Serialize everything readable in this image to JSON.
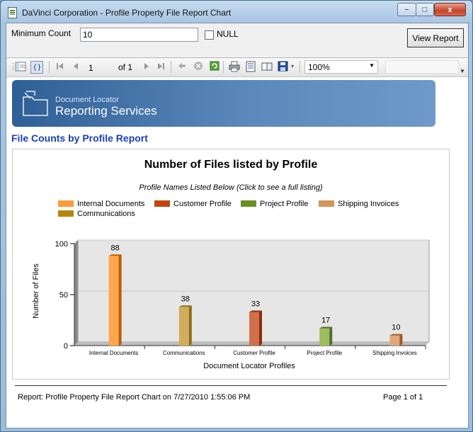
{
  "window": {
    "title": "DaVinci Corporation - Profile Property File Report Chart",
    "minimize_label": "−",
    "maximize_label": "□",
    "close_label": "x"
  },
  "params": {
    "minimum_count_label": "Minimum Count",
    "minimum_count_value": "10",
    "null_label": "NULL",
    "view_report_label": "View Report"
  },
  "toolbar": {
    "page_value": "1",
    "of_text": "of 1",
    "zoom_value": "100%"
  },
  "banner": {
    "subtitle": "Document Locator",
    "title": "Reporting Services"
  },
  "report": {
    "title": "File Counts by Profile Report"
  },
  "chart_data": {
    "type": "bar",
    "title": "Number of Files listed by Profile",
    "subtitle": "Profile Names Listed Below (Click to see a full listing)",
    "xlabel": "Document Locator Profiles",
    "ylabel": "Number of Files",
    "ylim": [
      0,
      100
    ],
    "yticks": [
      0,
      50,
      100
    ],
    "grid": true,
    "legend_position": "top",
    "categories": [
      "Internal Documents",
      "Communications",
      "Customer Profile",
      "Project Profile",
      "Shipping Invoices"
    ],
    "values": [
      88,
      38,
      33,
      17,
      10
    ],
    "series": [
      {
        "name": "Internal Documents",
        "value": 88,
        "color": "#ff9a3c"
      },
      {
        "name": "Customer Profile",
        "value": 33,
        "color": "#c0440c"
      },
      {
        "name": "Project Profile",
        "value": 17,
        "color": "#6b8e23"
      },
      {
        "name": "Shipping Invoices",
        "value": 10,
        "color": "#d2955a"
      },
      {
        "name": "Communications",
        "value": 38,
        "color": "#b8860b"
      }
    ],
    "bar_colors": [
      "#ffa64d",
      "#d2ad5e",
      "#d0704a",
      "#9dbd5e",
      "#e0a878"
    ],
    "bar_shade_colors": [
      "#c05a00",
      "#8c6e1c",
      "#8c2e0c",
      "#556b2f",
      "#a05a22"
    ]
  },
  "footer": {
    "left": "Report: Profile Property File Report Chart on 7/27/2010 1:55:06 PM",
    "right": "Page 1 of 1"
  }
}
